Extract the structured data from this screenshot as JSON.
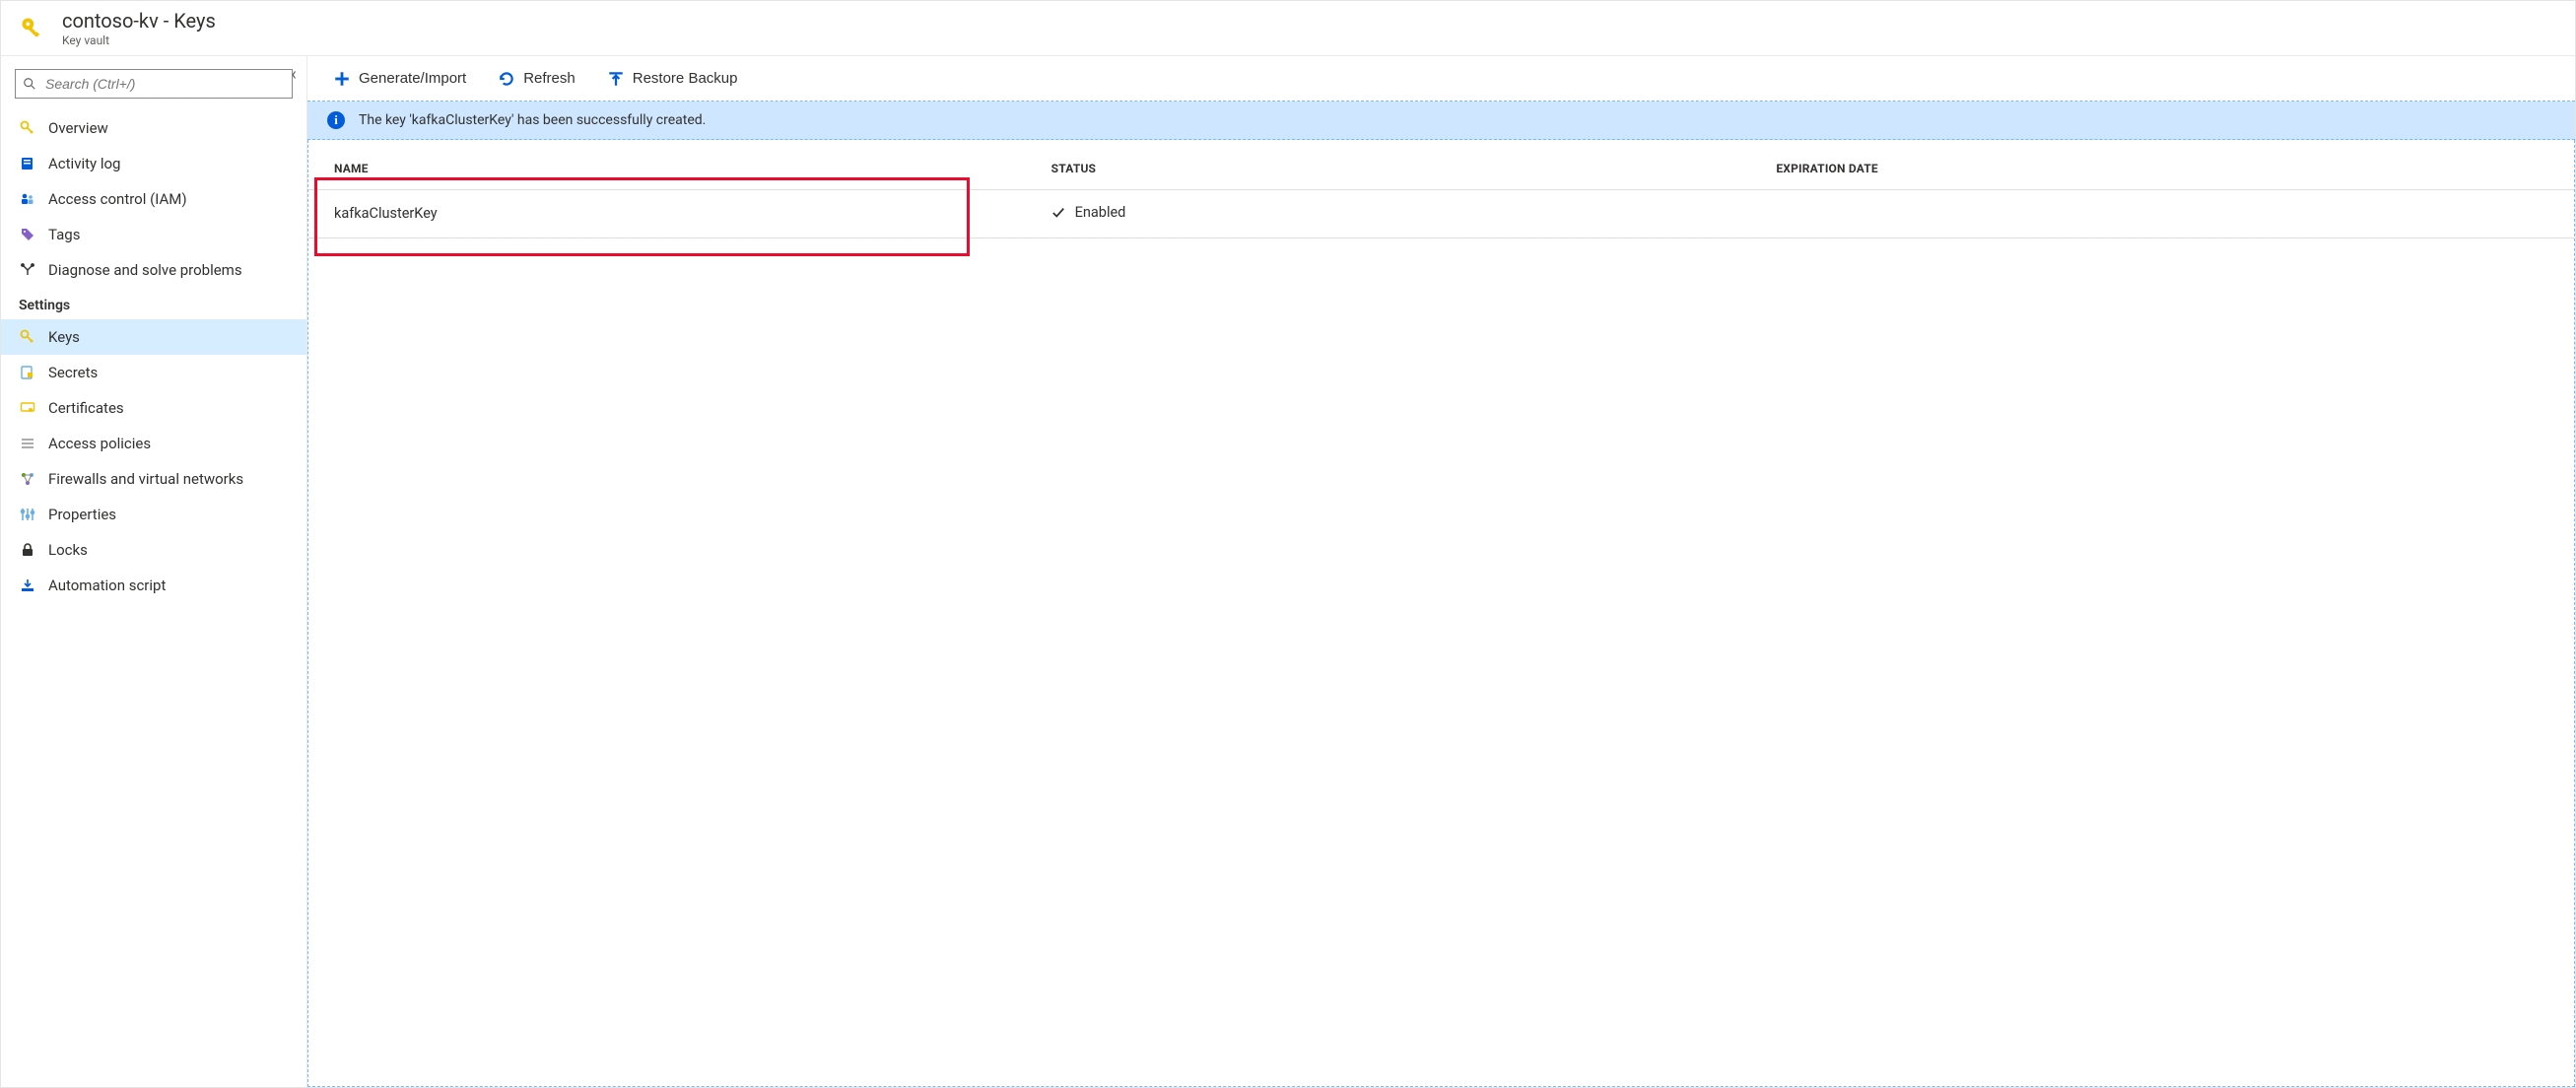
{
  "header": {
    "title": "contoso-kv - Keys",
    "subtitle": "Key vault"
  },
  "sidebar": {
    "search_placeholder": "Search (Ctrl+/)",
    "items": [
      {
        "label": "Overview"
      },
      {
        "label": "Activity log"
      },
      {
        "label": "Access control (IAM)"
      },
      {
        "label": "Tags"
      },
      {
        "label": "Diagnose and solve problems"
      }
    ],
    "settings_label": "Settings",
    "settings_items": [
      {
        "label": "Keys",
        "selected": true
      },
      {
        "label": "Secrets"
      },
      {
        "label": "Certificates"
      },
      {
        "label": "Access policies"
      },
      {
        "label": "Firewalls and virtual networks"
      },
      {
        "label": "Properties"
      },
      {
        "label": "Locks"
      },
      {
        "label": "Automation script"
      }
    ]
  },
  "toolbar": {
    "generate_label": "Generate/Import",
    "refresh_label": "Refresh",
    "restore_label": "Restore Backup"
  },
  "notification": {
    "message": "The key 'kafkaClusterKey' has been successfully created."
  },
  "table": {
    "col_name": "NAME",
    "col_status": "STATUS",
    "col_expiration": "EXPIRATION DATE",
    "rows": [
      {
        "name": "kafkaClusterKey",
        "status": "Enabled",
        "expiration": ""
      }
    ]
  }
}
